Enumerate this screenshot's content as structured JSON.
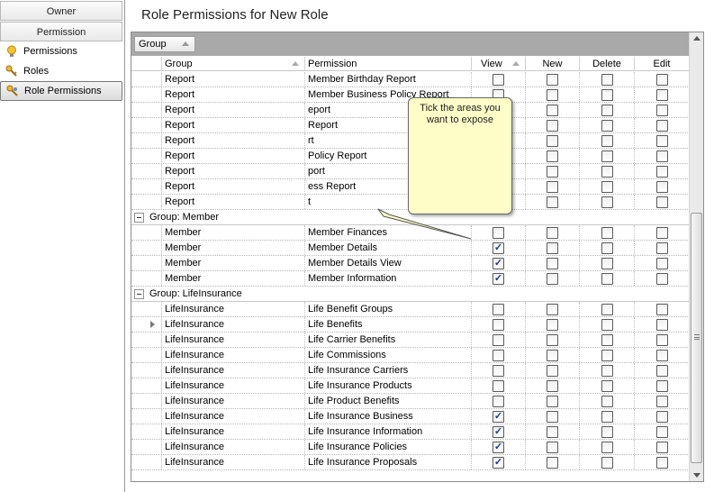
{
  "sidebar": {
    "owner_label": "Owner",
    "permission_label": "Permission",
    "items": [
      {
        "label": "Permissions",
        "icon": "bulb-icon"
      },
      {
        "label": "Roles",
        "icon": "keys-icon"
      },
      {
        "label": "Role Permissions",
        "icon": "role-keys-icon"
      }
    ]
  },
  "main": {
    "title": "Role Permissions for New Role",
    "groupby_chip": "Group",
    "headers": {
      "group": "Group",
      "permission": "Permission",
      "view": "View",
      "new": "New",
      "delete": "Delete",
      "edit": "Edit"
    },
    "tooltip": "Tick the areas you want to expose",
    "report_rows": [
      {
        "group": "Report",
        "permission": "Member Birthday Report"
      },
      {
        "group": "Report",
        "permission": "Member Business Policy Report"
      },
      {
        "group": "Report",
        "permission": "eport"
      },
      {
        "group": "Report",
        "permission": "Report"
      },
      {
        "group": "Report",
        "permission": "rt"
      },
      {
        "group": "Report",
        "permission": "Policy Report"
      },
      {
        "group": "Report",
        "permission": "port"
      },
      {
        "group": "Report",
        "permission": "ess Report"
      },
      {
        "group": "Report",
        "permission": "t"
      }
    ],
    "member_group_label": "Group:  Member",
    "member_rows": [
      {
        "group": "Member",
        "permission": "Member Finances",
        "view": false
      },
      {
        "group": "Member",
        "permission": "Member Details",
        "view": true
      },
      {
        "group": "Member",
        "permission": "Member Details View",
        "view": true
      },
      {
        "group": "Member",
        "permission": "Member Information",
        "view": true
      }
    ],
    "life_group_label": "Group:  LifeInsurance",
    "life_rows": [
      {
        "group": "LifeInsurance",
        "permission": "Life Benefit Groups",
        "view": false
      },
      {
        "group": "LifeInsurance",
        "permission": "Life Benefits",
        "view": false
      },
      {
        "group": "LifeInsurance",
        "permission": "Life Carrier Benefits",
        "view": false
      },
      {
        "group": "LifeInsurance",
        "permission": "Life Commissions",
        "view": false
      },
      {
        "group": "LifeInsurance",
        "permission": "Life Insurance Carriers",
        "view": false
      },
      {
        "group": "LifeInsurance",
        "permission": "Life Insurance Products",
        "view": false
      },
      {
        "group": "LifeInsurance",
        "permission": "Life Product Benefits",
        "view": false
      },
      {
        "group": "LifeInsurance",
        "permission": "Life Insurance Business",
        "view": true
      },
      {
        "group": "LifeInsurance",
        "permission": "Life Insurance Information",
        "view": true
      },
      {
        "group": "LifeInsurance",
        "permission": "Life Insurance Policies",
        "view": true
      },
      {
        "group": "LifeInsurance",
        "permission": "Life Insurance Proposals",
        "view": true
      }
    ]
  }
}
